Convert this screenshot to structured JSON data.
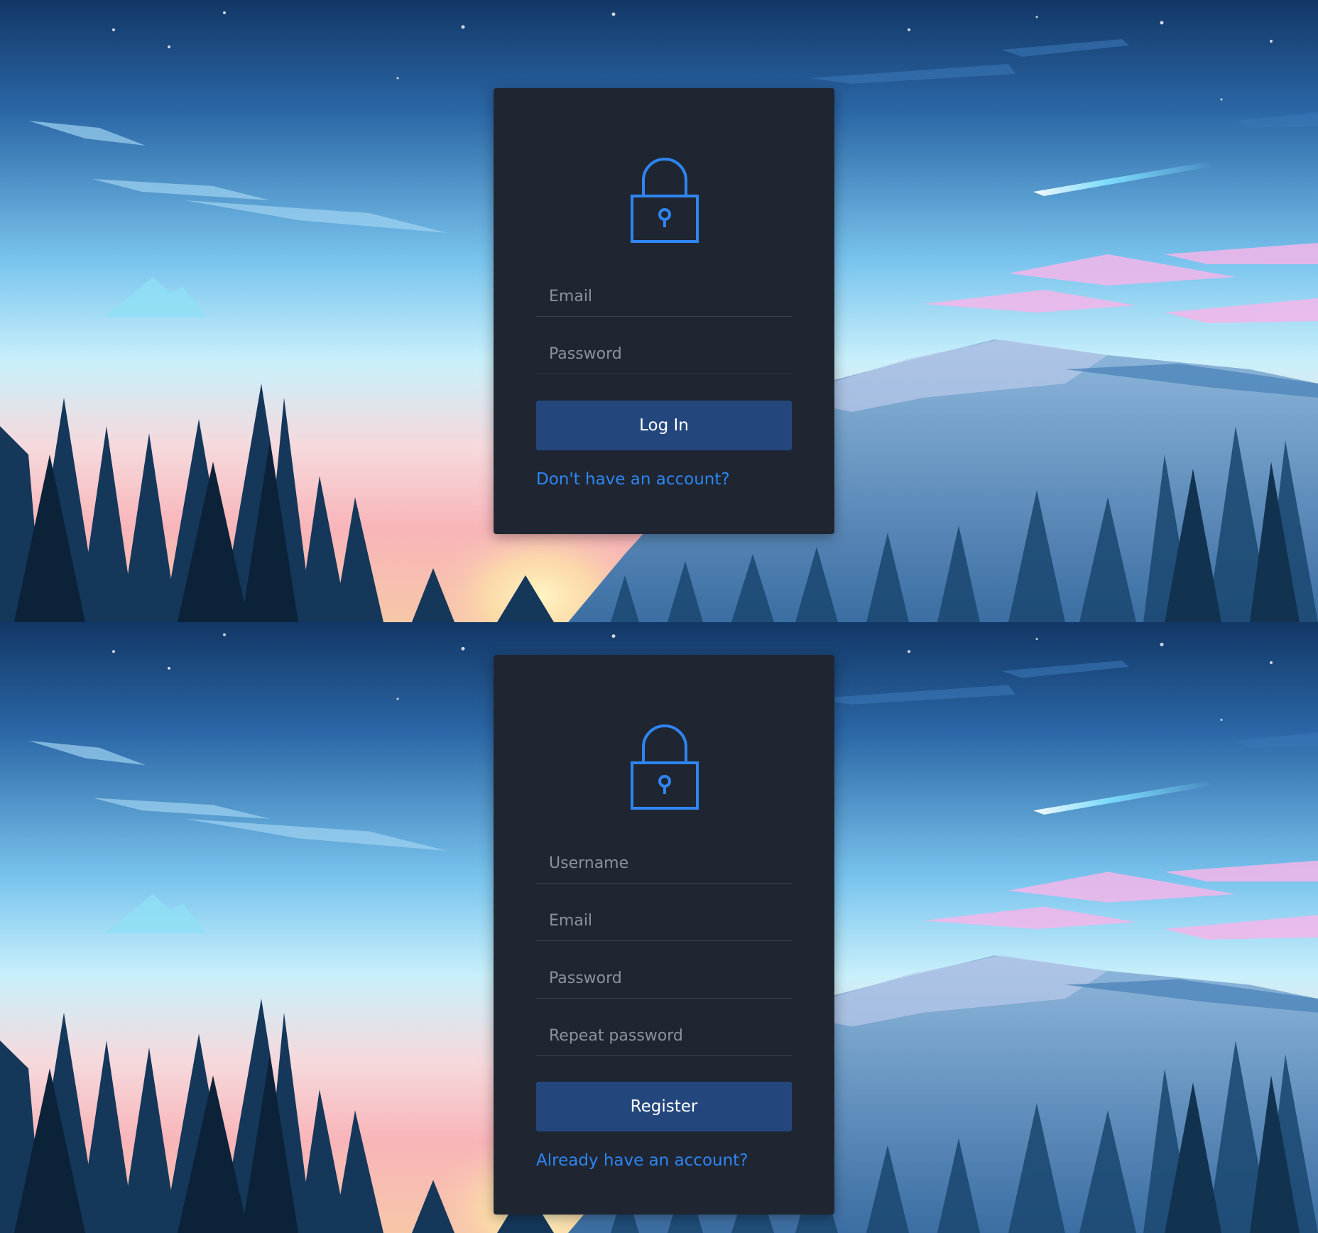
{
  "colors": {
    "card_bg": "#1f2631",
    "accent": "#2f86f2",
    "button_bg": "#23477d",
    "placeholder": "#8b929c",
    "divider": "#3a414c"
  },
  "login": {
    "icon": "lock-icon",
    "email_placeholder": "Email",
    "password_placeholder": "Password",
    "submit_label": "Log In",
    "switch_link": "Don't have an account?"
  },
  "register": {
    "icon": "lock-icon",
    "username_placeholder": "Username",
    "email_placeholder": "Email",
    "password_placeholder": "Password",
    "repeat_password_placeholder": "Repeat password",
    "submit_label": "Register",
    "switch_link": "Already have an account?"
  }
}
